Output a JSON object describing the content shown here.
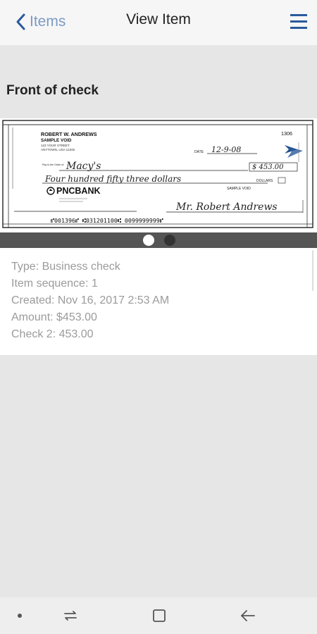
{
  "header": {
    "back_label": "Items",
    "title": "View Item",
    "menu_icon": "hamburger-menu-icon",
    "back_icon": "chevron-left-icon",
    "accent_color": "#2a5a9c"
  },
  "section": {
    "title": "Front of check"
  },
  "check": {
    "account_name": "ROBERT W. ANDREWS",
    "account_sub": "SAMPLE VOID",
    "address_line1": "123 YOUR STREET",
    "address_line2": "ANYTOWN, USA 12345",
    "check_number": "1306",
    "date_label": "DATE",
    "date_value": "12-9-08",
    "pay_to_label": "Pay to the Order of",
    "payee": "Macy's",
    "amount_value": "$ 453.00",
    "amount_words": "Four hundred fifty three dollars",
    "dollars_label": "DOLLARS",
    "bank_name": "PNCBANK",
    "void_label": "SAMPLE VOID",
    "signature": "Mr. Robert Andrews",
    "micr_line": "⑈001396⑈ ⑆031201100⑆ 0099999999⑈"
  },
  "carousel": {
    "total_pages": 2,
    "active_page": 1
  },
  "details": {
    "type": "Type: Business check",
    "sequence": "Item sequence: 1",
    "created": "Created: Nov 16, 2017 2:53 AM",
    "amount": "Amount: $453.00",
    "check2": "Check 2: 453.00"
  },
  "system_nav": {
    "icons": [
      "dot-icon",
      "recent-apps-icon",
      "home-icon",
      "back-arrow-icon"
    ]
  }
}
